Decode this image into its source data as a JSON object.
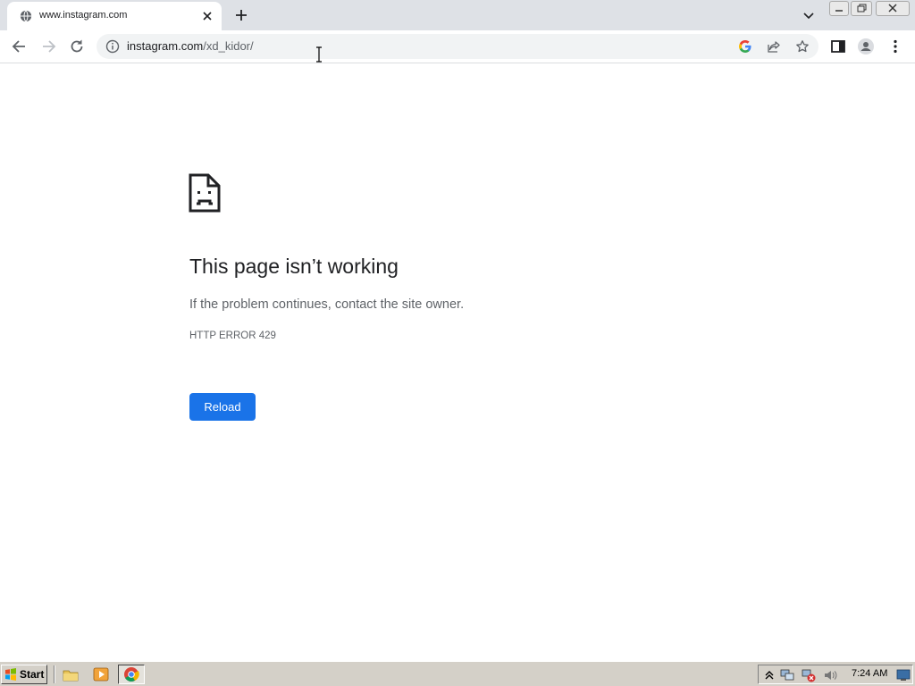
{
  "browser": {
    "tab": {
      "title": "www.instagram.com",
      "favicon": "globe-icon",
      "close_icon": "close-icon"
    },
    "new_tab_icon": "plus-icon",
    "tab_search_icon": "chevron-down-icon",
    "window_controls": [
      "minimize-icon",
      "restore-icon",
      "close-icon"
    ],
    "toolbar": {
      "back_icon": "arrow-left-icon",
      "forward_icon": "arrow-right-icon",
      "reload_icon": "reload-icon",
      "site_info_icon": "info-icon",
      "url_host": "instagram.com",
      "url_path": "/xd_kidor/",
      "google_lens_icon": "google-g-icon",
      "share_icon": "share-icon",
      "bookmark_icon": "star-icon",
      "side_panel_icon": "side-panel-icon",
      "profile_icon": "avatar-icon",
      "menu_icon": "kebab-menu-icon"
    }
  },
  "error_page": {
    "icon": "sad-page-icon",
    "title": "This page isn’t working",
    "description": "If the problem continues, contact the site owner.",
    "error_code": "HTTP ERROR 429",
    "reload_label": "Reload"
  },
  "taskbar": {
    "start_label": "Start",
    "quick_launch": [
      "folder-icon",
      "media-player-icon",
      "chrome-icon"
    ],
    "tray_icons": [
      "show-hidden-icon",
      "network-icon",
      "network-error-icon",
      "volume-icon"
    ],
    "clock": "7:24 AM",
    "show_desktop_icon": "desktop-icon"
  },
  "colors": {
    "accent": "#1a73e8",
    "tabstrip": "#dee1e6",
    "omnibox": "#f1f3f4",
    "taskbar": "#d4d0c8",
    "title_text": "#202124",
    "secondary_text": "#5f6368"
  }
}
